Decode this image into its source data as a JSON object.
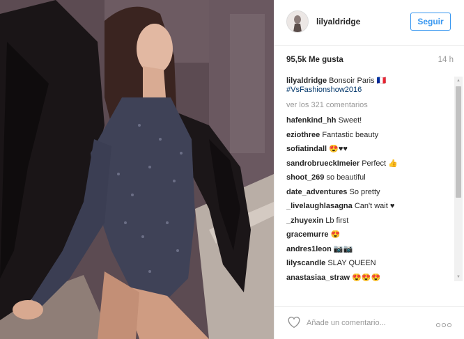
{
  "post": {
    "username": "lilyaldridge",
    "follow_label": "Seguir",
    "likes": "95,5k Me gusta",
    "time": "14 h",
    "caption": {
      "username": "lilyaldridge",
      "text": "Bonsoir Paris 🇫🇷",
      "hashtag": "#VsFashionshow2016"
    },
    "view_all": "ver los 321 comentarios",
    "comments": [
      {
        "user": "hafenkind_hh",
        "text": "Sweet!"
      },
      {
        "user": "eziothree",
        "text": "Fantastic beauty"
      },
      {
        "user": "sofiatindall",
        "text": "😍♥♥"
      },
      {
        "user": "sandrobrueckImeier",
        "text": "Perfect 👍"
      },
      {
        "user": "shoot_269",
        "text": "so beautiful"
      },
      {
        "user": "date_adventures",
        "text": "So pretty"
      },
      {
        "user": "_livelaughlasagna",
        "text": "Can't wait ♥"
      },
      {
        "user": "_zhuyexin",
        "text": "Lb first"
      },
      {
        "user": "gracemurre",
        "text": "😍"
      },
      {
        "user": "andres1leon",
        "text": "📷📷"
      },
      {
        "user": "lilyscandle",
        "text": "SLAY QUEEN"
      },
      {
        "user": "anastasiaa_straw",
        "text": "😍😍😍"
      }
    ],
    "add_comment_placeholder": "Añade un comentario...",
    "icons": {
      "like": "heart-icon",
      "options": "more-options-icon",
      "avatar": "profile-avatar"
    },
    "colors": {
      "follow": "#3897f0",
      "hashtag": "#003569",
      "muted": "#999999"
    }
  }
}
